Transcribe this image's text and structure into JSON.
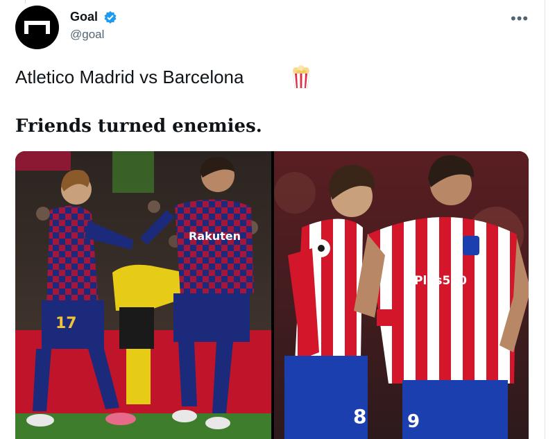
{
  "author": {
    "name": "Goal",
    "handle": "@goal",
    "verified_icon": "verified-badge-icon",
    "avatar_icon": "goal-logo-icon"
  },
  "menu": {
    "icon": "more-options-icon",
    "glyph": "•••"
  },
  "tweet": {
    "line1": "Atletico Madrid vs Barcelona",
    "line1_emoji": "popcorn-icon",
    "line2": "Friends turned enemies."
  },
  "photos": {
    "left": {
      "sponsor": "Rakuten",
      "number": "17"
    },
    "right": {
      "sponsor": "Plus500",
      "number_left": "8",
      "number_right": "9"
    }
  },
  "colors": {
    "text": "#0f1419",
    "secondary": "#536471",
    "verified": "#1d9bf0",
    "barca_blue": "#1b2a7a",
    "barca_red": "#a4173a",
    "atleti_red": "#d4162b",
    "atleti_blue": "#1c3fb0"
  }
}
